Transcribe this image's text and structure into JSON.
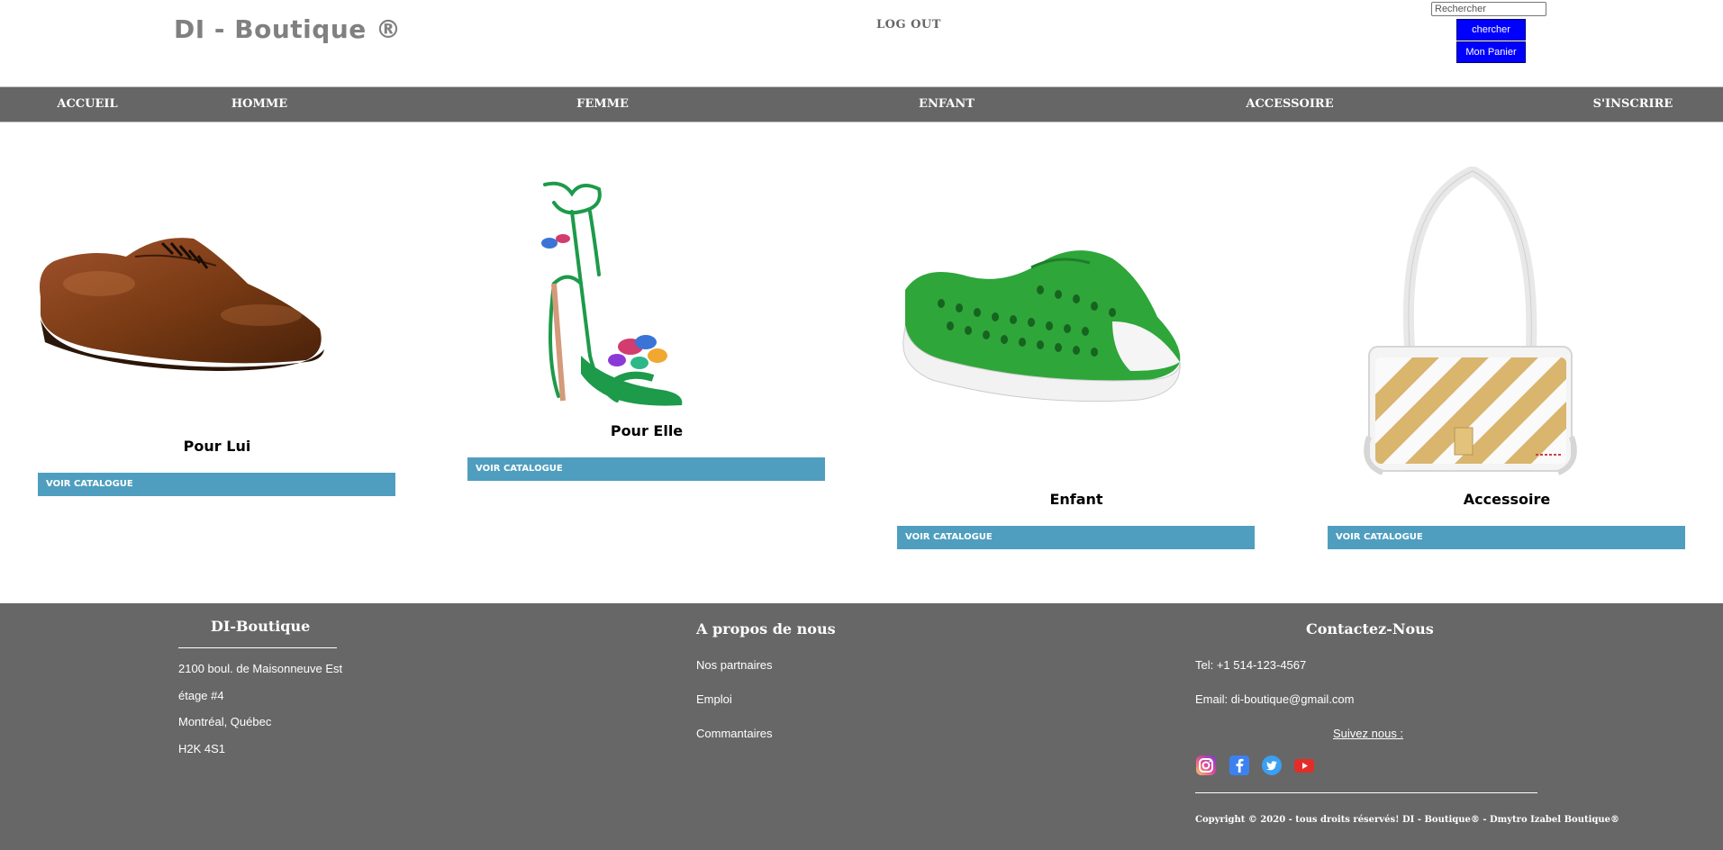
{
  "header": {
    "brand": "DI - Boutique ®",
    "logout": "LOG OUT",
    "search_placeholder": "Rechercher",
    "search_button": "chercher",
    "cart_button": "Mon Panier"
  },
  "nav": {
    "items": [
      "ACCUEIL",
      "HOMME",
      "FEMME",
      "ENFANT",
      "ACCESSOIRE",
      "S'INSCRIRE"
    ]
  },
  "products": [
    {
      "title": "Pour Lui",
      "button": "VOIR CATALOGUE",
      "image": "brown-oxford-shoe"
    },
    {
      "title": "Pour Elle",
      "button": "VOIR CATALOGUE",
      "image": "green-heeled-sandal"
    },
    {
      "title": "Enfant",
      "button": "VOIR CATALOGUE",
      "image": "green-kids-sneaker"
    },
    {
      "title": "Accessoire",
      "button": "VOIR CATALOGUE",
      "image": "white-striped-handbag"
    }
  ],
  "footer": {
    "col1": {
      "title": "DI-Boutique",
      "lines": [
        "2100 boul. de Maisonneuve Est",
        "étage #4",
        "Montréal, Québec",
        "H2K 4S1"
      ]
    },
    "col2": {
      "title": "A propos de nous",
      "links": [
        "Nos partnaires",
        "Emploi",
        "Commantaires"
      ]
    },
    "col3": {
      "title": "Contactez-Nous",
      "tel": "Tel: +1 514-123-4567",
      "email": "Email: di-boutique@gmail.com",
      "follow": "Suivez nous :",
      "social_icons": [
        "instagram-icon",
        "facebook-icon",
        "twitter-icon",
        "youtube-icon"
      ]
    },
    "copyright": "Copyright © 2020 - tous droits réservés! DI - Boutique® - Dmytro Izabel Boutique®"
  },
  "colors": {
    "nav_bg": "#666666",
    "footer_bg": "#676767",
    "button_blue": "#0000ff",
    "catalog_button": "#4f9ebf"
  }
}
